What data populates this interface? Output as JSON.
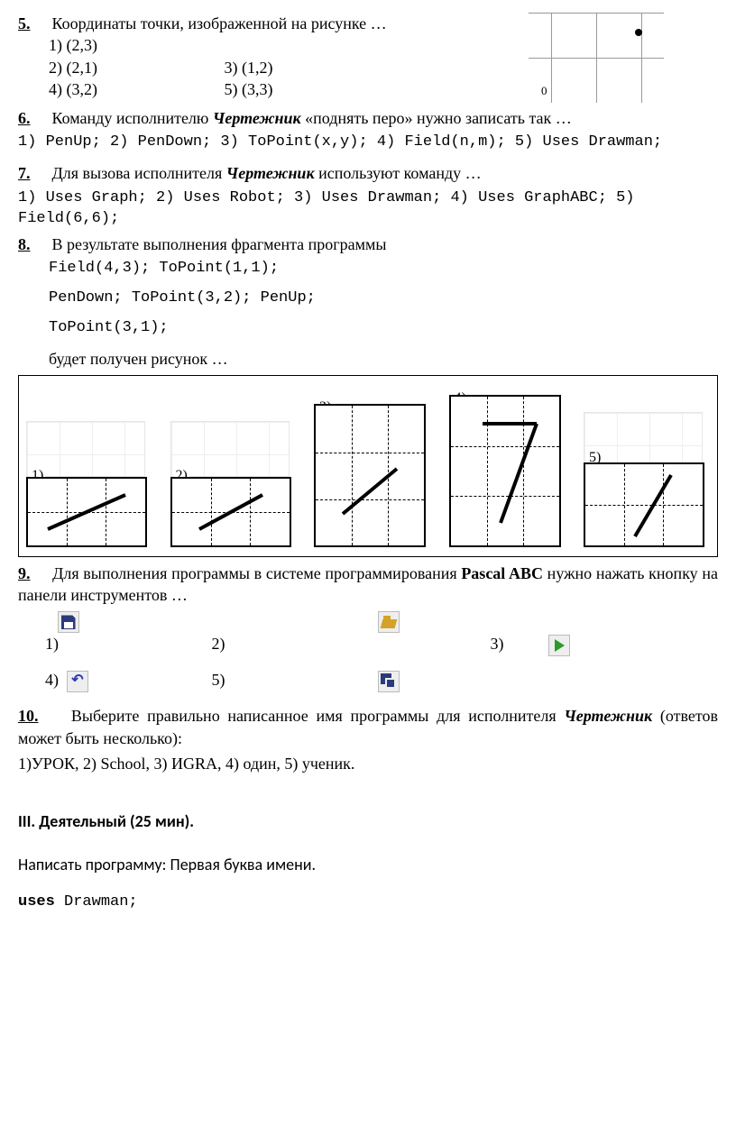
{
  "q5": {
    "num": "5.",
    "text": "Координаты точки, изображенной на рисунке …",
    "opts": [
      "1) (2,3)",
      "2) (2,1)",
      "3) (1,2)",
      "4) (3,2)",
      "5) (3,3)"
    ],
    "origin": "0"
  },
  "q6": {
    "num": "6.",
    "text_parts": [
      "Команду исполнителю ",
      "Чертежник",
      " «поднять перо» нужно записать так …"
    ],
    "opts": "1) PenUp; 2) PenDown;   3) ToPoint(x,y); 4) Field(n,m); 5) Uses Drawman;"
  },
  "q7": {
    "num": "7.",
    "text_parts": [
      "Для вызова исполнителя ",
      "Чертежник",
      " используют команду …"
    ],
    "opts": "1) Uses Graph; 2) Uses Robot;   3) Uses Drawman; 4) Uses GraphABC; 5) Field(6,6);"
  },
  "q8": {
    "num": "8.",
    "lead": "В результате выполнения фрагмента программы",
    "code1": "Field(4,3);          ToPoint(1,1);",
    "code2": "PenDown;    ToPoint(3,2);    PenUp;",
    "code3": "ToPoint(3,1);",
    "tail": "будет получен рисунок …",
    "labels": [
      "1)",
      "2)",
      "3)",
      "4)",
      "5)"
    ]
  },
  "q9": {
    "num": "9.",
    "text_parts": [
      "Для выполнения программы в системе программирования ",
      "Pascal ABC",
      " нужно нажать кнопку на панели инструментов …"
    ],
    "opts": [
      "1)",
      "2)",
      "3)",
      "4)",
      "5)"
    ]
  },
  "q10": {
    "num": "10.",
    "text_parts": [
      "Выберите правильно написанное имя программы для исполнителя ",
      "Чертежник",
      " (ответов может быть несколько):"
    ],
    "opts": "1)УРОК,   2) School, 3) ИGRA, 4) один, 5) ученик."
  },
  "section3": "III. Деятельный (25 мин).",
  "task": "Написать программу: Первая буква имени.",
  "program_line": [
    "uses",
    " Drawman;"
  ]
}
